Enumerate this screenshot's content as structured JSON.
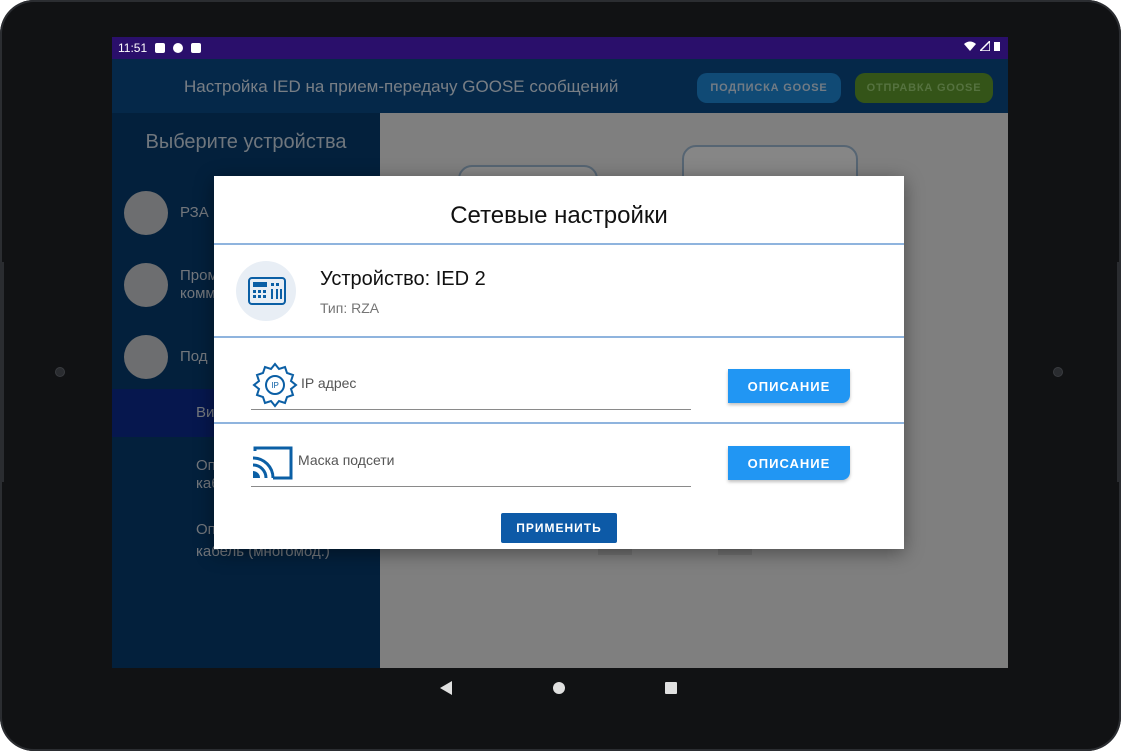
{
  "status": {
    "time": "11:51"
  },
  "appbar": {
    "title": "Настройка IED на прием-передачу GOOSE сообщений",
    "subscribe_label": "ПОДПИСКА GOOSE",
    "send_label": "ОТПРАВКА GOOSE"
  },
  "sidebar": {
    "heading": "Выберите устройства",
    "items": [
      {
        "label": "РЗА"
      },
      {
        "label": "Пром",
        "label2": "комм"
      },
      {
        "label": "Под"
      }
    ],
    "subitems": [
      {
        "label": "Ви"
      },
      {
        "label": "Оп",
        "label2": "каб"
      },
      {
        "label": "Оп",
        "label2": "кабель (многомод.)"
      }
    ]
  },
  "dialog": {
    "title": "Сетевые настройки",
    "device_name": "Устройство: IED 2",
    "device_type": "Тип: RZA",
    "ip_label": "IP адрес",
    "ip_icon_text": "IP",
    "mask_label": "Маска подсети",
    "desc_button": "ОПИСАНИЕ",
    "apply_button": "ПРИМЕНИТЬ"
  },
  "colors": {
    "appbar": "#0a4a85",
    "sidebar": "#073b6d",
    "accent": "#2196f3",
    "apply": "#0d5aa7",
    "divider": "#8fb4de"
  }
}
